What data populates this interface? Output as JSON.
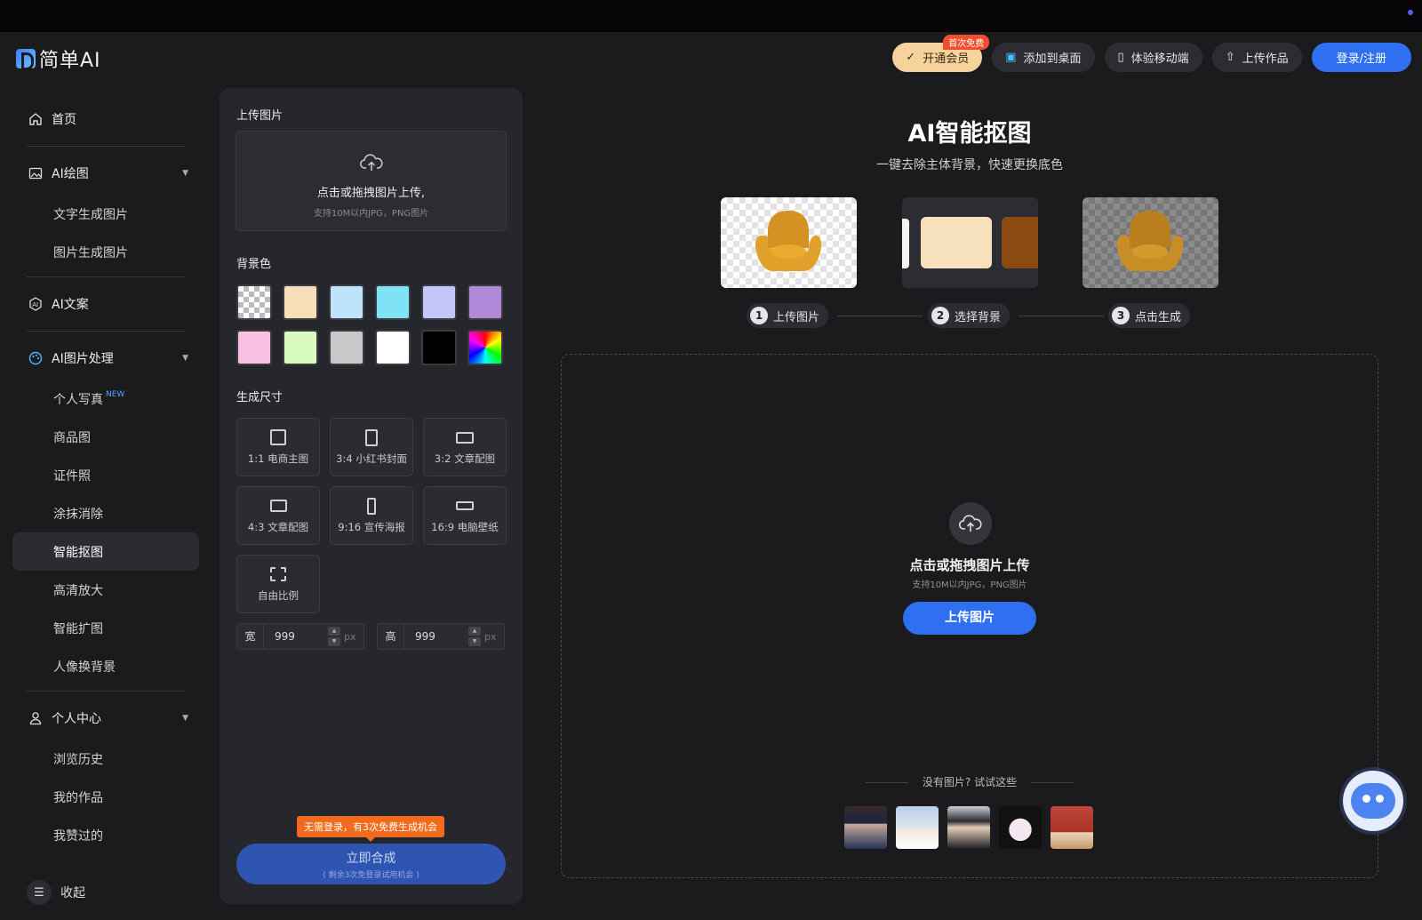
{
  "app": {
    "name": "简单AI"
  },
  "header": {
    "vip_label": "开通会员",
    "vip_badge": "首次免费",
    "add_desktop_label": "添加到桌面",
    "mobile_label": "体验移动端",
    "upload_work_label": "上传作品",
    "login_label": "登录/注册",
    "accent_color": "#2f6ff1"
  },
  "sidebar": {
    "home": "首页",
    "ai_draw": {
      "label": "AI绘图",
      "items": [
        "文字生成图片",
        "图片生成图片"
      ]
    },
    "ai_copy": "AI文案",
    "ai_image": {
      "label": "AI图片处理",
      "items": [
        {
          "label": "个人写真",
          "tag": "NEW"
        },
        {
          "label": "商品图"
        },
        {
          "label": "证件照"
        },
        {
          "label": "涂抹消除"
        },
        {
          "label": "智能抠图",
          "active": true
        },
        {
          "label": "高清放大"
        },
        {
          "label": "智能扩图"
        },
        {
          "label": "人像换背景"
        }
      ]
    },
    "personal": {
      "label": "个人中心",
      "items": [
        "浏览历史",
        "我的作品",
        "我赞过的"
      ]
    },
    "collapse_label": "收起"
  },
  "panel": {
    "upload_title": "上传图片",
    "upload_main": "点击或拖拽图片上传,",
    "upload_sub": "支持10M以内JPG，PNG图片",
    "bg_title": "背景色",
    "bg_colors": [
      "transparent",
      "#f6dfb8",
      "#bfe3fb",
      "#7fe2f5",
      "#c4c6fb",
      "#b089d8",
      "#f8bfe2",
      "#d9fbc0",
      "#c8c8c8",
      "#ffffff",
      "#000000",
      "rainbow"
    ],
    "size_title": "生成尺寸",
    "sizes": [
      {
        "label": "1:1 电商主图",
        "ratio": "1:1"
      },
      {
        "label": "3:4 小红书封面",
        "ratio": "3:4"
      },
      {
        "label": "3:2 文章配图",
        "ratio": "3:2"
      },
      {
        "label": "4:3 文章配图",
        "ratio": "4:3"
      },
      {
        "label": "9:16 宣传海报",
        "ratio": "9:16"
      },
      {
        "label": "16:9 电脑壁纸",
        "ratio": "16:9"
      },
      {
        "label": "自由比例",
        "ratio": "free"
      }
    ],
    "width_label": "宽",
    "width_value": "999",
    "height_label": "高",
    "height_value": "999",
    "unit": "px",
    "promo_text": "无需登录，有3次免费生成机会",
    "generate_label": "立即合成",
    "generate_sub": "( 剩余3次免登录试用机会 )"
  },
  "main": {
    "title": "AI智能抠图",
    "subtitle": "一键去除主体背景，快速更换底色",
    "steps": [
      {
        "num": "1",
        "label": "上传图片"
      },
      {
        "num": "2",
        "label": "选择背景"
      },
      {
        "num": "3",
        "label": "点击生成"
      }
    ],
    "drop_main": "点击或拖拽图片上传",
    "drop_sub": "支持10M以内JPG，PNG图片",
    "drop_button": "上传图片",
    "try_label": "没有图片? 试试这些"
  }
}
